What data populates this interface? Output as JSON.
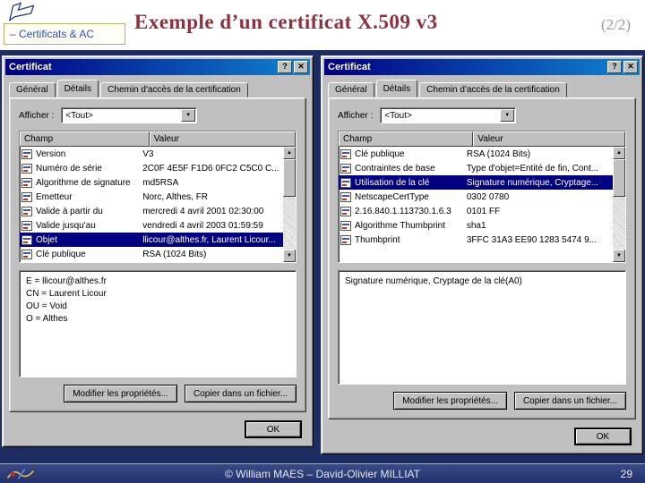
{
  "header": {
    "section_label": "– Certificats & AC",
    "title": "Exemple d’un certificat X.509 v3",
    "page_indicator": "(2/2)"
  },
  "chrome": {
    "help_glyph": "?",
    "close_glyph": "✕",
    "dropdown_glyph": "▼",
    "scroll_up_glyph": "▲",
    "scroll_down_glyph": "▼"
  },
  "dialog_left": {
    "title": "Certificat",
    "tabs": [
      {
        "label": "Général"
      },
      {
        "label": "Détails",
        "active": true
      },
      {
        "label": "Chemin d'accès de la certification"
      }
    ],
    "show_label": "Afficher :",
    "show_value": "<Tout>",
    "columns": [
      "Champ",
      "Valeur"
    ],
    "rows": [
      {
        "field": "Version",
        "value": "V3"
      },
      {
        "field": "Numéro de série",
        "value": "2C0F 4E5F F1D6 0FC2 C5C0 C..."
      },
      {
        "field": "Algorithme de signature",
        "value": "md5RSA"
      },
      {
        "field": "Emetteur",
        "value": "Norc, Althes, FR"
      },
      {
        "field": "Valide à partir du",
        "value": "mercredi 4 avril 2001 02:30:00"
      },
      {
        "field": "Valide jusqu'au",
        "value": "vendredi 4 avril 2003 01:59:59"
      },
      {
        "field": "Objet",
        "value": "llicour@althes.fr, Laurent Licour...",
        "selected": true
      },
      {
        "field": "Clé publique",
        "value": "RSA (1024 Bits)"
      }
    ],
    "detail_lines": [
      "E = llicour@althes.fr",
      "CN = Laurent Licour",
      "OU = Void",
      "O = Althes"
    ],
    "edit_button": "Modifier les propriétés...",
    "copy_button": "Copier dans un fichier...",
    "ok_button": "OK"
  },
  "dialog_right": {
    "title": "Certificat",
    "tabs": [
      {
        "label": "Général"
      },
      {
        "label": "Détails",
        "active": true
      },
      {
        "label": "Chemin d'accès de la certification"
      }
    ],
    "show_label": "Afficher :",
    "show_value": "<Tout>",
    "columns": [
      "Champ",
      "Valeur"
    ],
    "rows": [
      {
        "field": "Clé publique",
        "value": "RSA (1024 Bits)"
      },
      {
        "field": "Contraintes de base",
        "value": "Type d'objet=Entité de fin, Cont..."
      },
      {
        "field": "Utilisation de la clé",
        "value": "Signature numérique, Cryptage...",
        "selected": true
      },
      {
        "field": "NetscapeCertType",
        "value": "0302 0780"
      },
      {
        "field": "2.16.840.1.113730.1.6.3",
        "value": "0101 FF"
      },
      {
        "field": "Algorithme Thumbprint",
        "value": "sha1"
      },
      {
        "field": "Thumbprint",
        "value": "3FFC 31A3 EE90 1283 5474 9..."
      }
    ],
    "detail_lines": [
      "Signature numérique, Cryptage de la clé(A0)"
    ],
    "edit_button": "Modifier les propriétés...",
    "copy_button": "Copier dans un fichier...",
    "ok_button": "OK"
  },
  "footer": {
    "credit": "© William MAES – David-Olivier MILLIAT",
    "page_number": "29"
  }
}
